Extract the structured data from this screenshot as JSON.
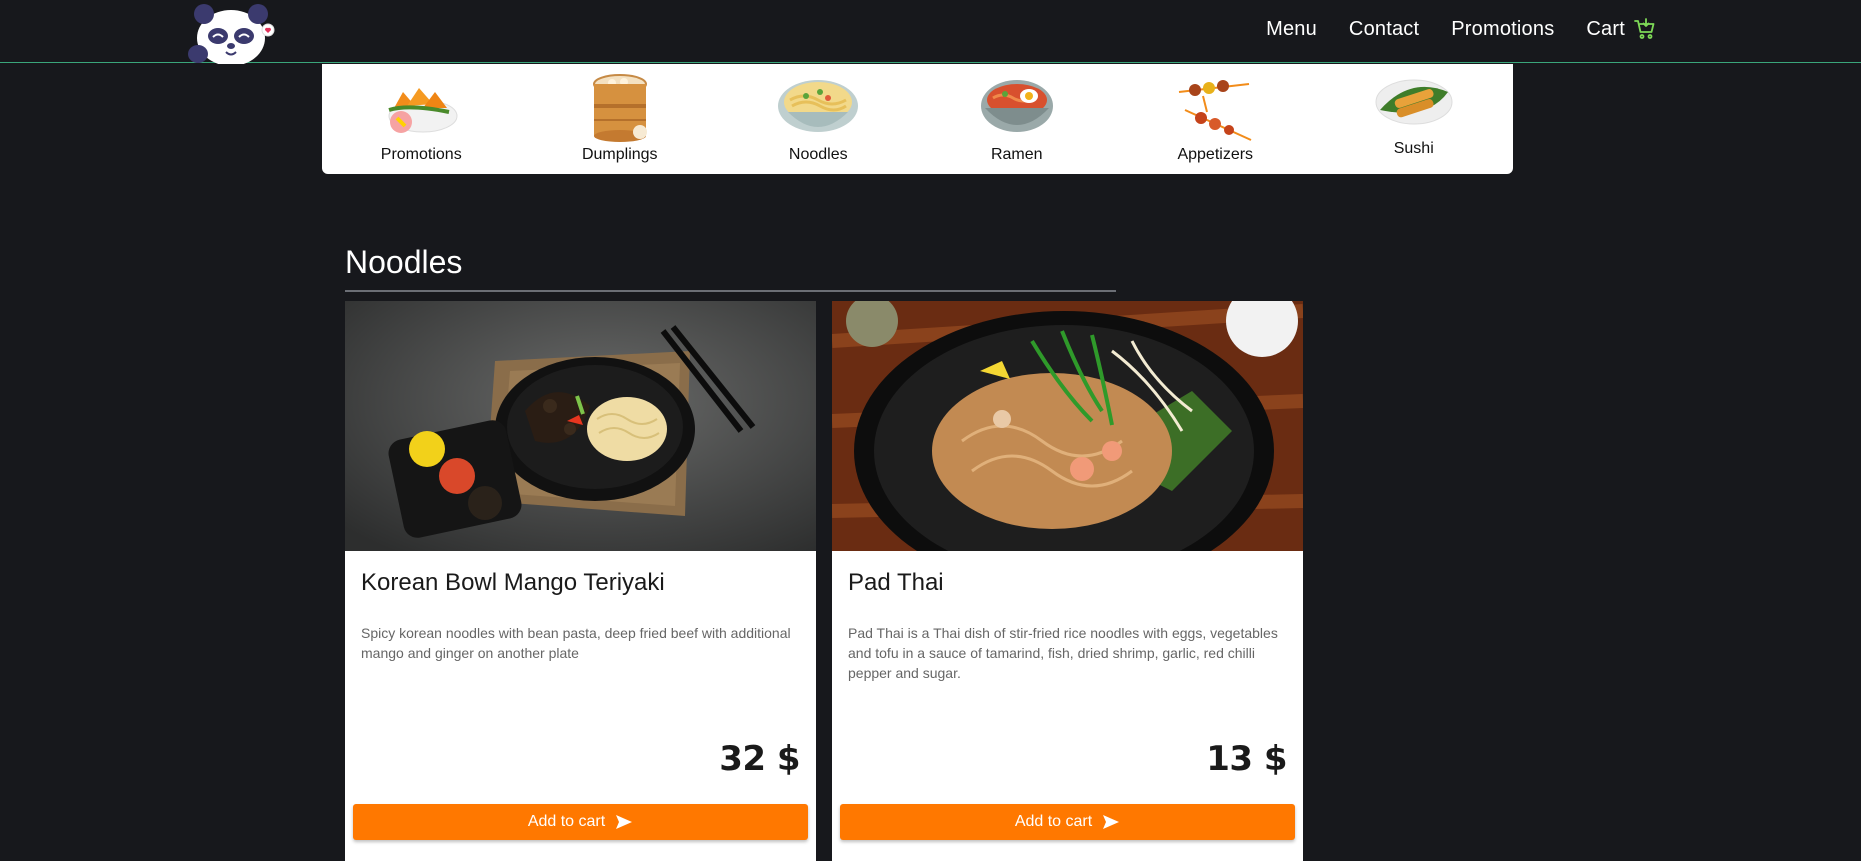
{
  "nav": {
    "items": [
      "Menu",
      "Contact",
      "Promotions"
    ],
    "cart_label": "Cart"
  },
  "categories": [
    {
      "label": "Promotions",
      "icon": "promotions-dish-icon"
    },
    {
      "label": "Dumplings",
      "icon": "dumplings-steamer-icon"
    },
    {
      "label": "Noodles",
      "icon": "noodles-bowl-icon"
    },
    {
      "label": "Ramen",
      "icon": "ramen-bowl-icon"
    },
    {
      "label": "Appetizers",
      "icon": "skewers-icon"
    },
    {
      "label": "Sushi",
      "icon": "spring-rolls-icon"
    }
  ],
  "section": {
    "title": "Noodles"
  },
  "products": [
    {
      "title": "Korean Bowl Mango Teriyaki",
      "description": "Spicy korean noodles with bean pasta, deep fried beef with additional mango and ginger on another plate",
      "price": "32 $",
      "button_label": "Add to cart"
    },
    {
      "title": "Pad Thai",
      "description": "Pad Thai is a Thai dish of stir-fried rice noodles with eggs, vegetables and tofu in a sauce of tamarind, fish, dried shrimp, garlic, red chilli pepper and sugar.",
      "price": "13 $",
      "button_label": "Add to cart"
    }
  ],
  "colors": {
    "background": "#17181c",
    "accent_button": "#ff7800",
    "header_border": "#3aa57a",
    "cart_icon": "#7ed957"
  }
}
